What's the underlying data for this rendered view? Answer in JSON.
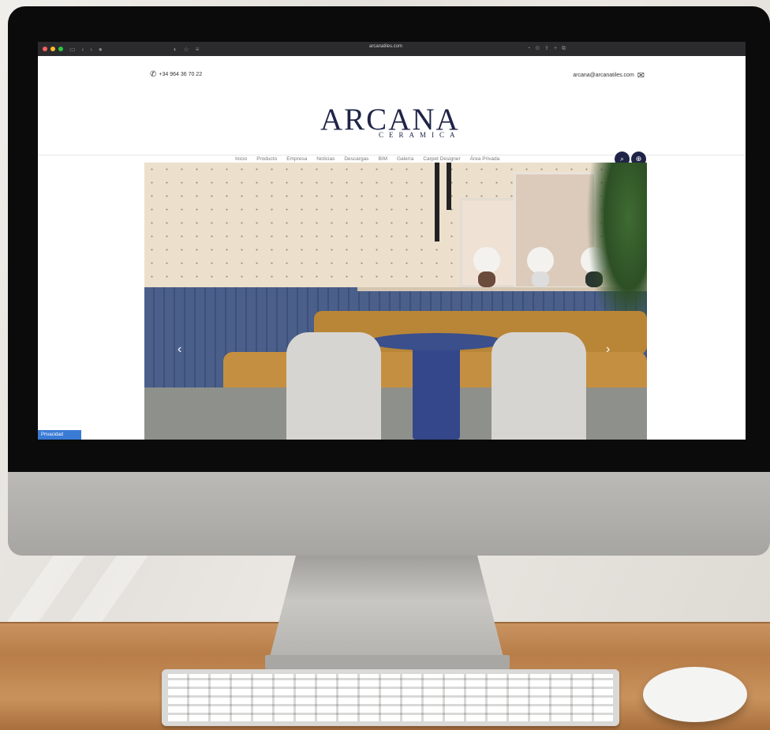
{
  "browser": {
    "url": "arcanatiles.com"
  },
  "site": {
    "phone": "+34 964 36 70 22",
    "email": "arcana@arcanatiles.com",
    "logo_main": "ARCANA",
    "logo_sub": "CERAMICA",
    "nav": [
      "Inicio",
      "Producto",
      "Empresa",
      "Noticias",
      "Descargas",
      "BIM",
      "Galería",
      "Carpet Designer",
      "Área Privada"
    ],
    "privacy_label": "Privacidad",
    "colors": {
      "brand": "#1f2447",
      "privacy": "#3a7bd5"
    }
  },
  "icons": {
    "phone": "phone-icon",
    "email": "envelope-icon",
    "search": "search-icon",
    "language": "globe-icon"
  }
}
